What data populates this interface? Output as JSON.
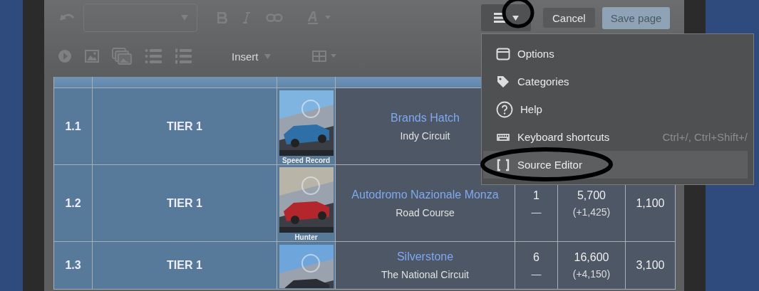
{
  "toolbar": {
    "insert_label": "Insert",
    "cancel": "Cancel",
    "save": "Save page"
  },
  "menu": {
    "open": true,
    "items": [
      {
        "kind": "options",
        "label": "Options",
        "selected": false
      },
      {
        "kind": "categories",
        "label": "Categories",
        "selected": false
      },
      {
        "kind": "help",
        "label": "Help",
        "selected": false
      },
      {
        "kind": "keyboard",
        "label": "Keyboard shortcuts",
        "shortcut": "Ctrl+/, Ctrl+Shift+/",
        "selected": false
      },
      {
        "kind": "source",
        "label": "Source Editor",
        "selected": true
      }
    ]
  },
  "table": {
    "rows": [
      {
        "number": "1.1",
        "tier": "TIER 1",
        "picture_caption": "Speed Record",
        "track": "Brands Hatch",
        "layout": "Indy Circuit"
      },
      {
        "number": "1.2",
        "tier": "TIER 1",
        "picture_caption": "Hunter",
        "track": "Autodromo Nazionale Monza",
        "layout": "Road Course",
        "column_5": [
          "1",
          "—"
        ],
        "column_6": [
          "5,700",
          "(+1,425)"
        ],
        "column_7": "1,100"
      },
      {
        "number": "1.3",
        "tier": "TIER 1",
        "track": "Silverstone",
        "layout": "The National Circuit",
        "column_5": [
          "6",
          "—"
        ],
        "column_6": [
          "16,600",
          "(+4,150)"
        ],
        "column_7": "3,100"
      }
    ]
  }
}
